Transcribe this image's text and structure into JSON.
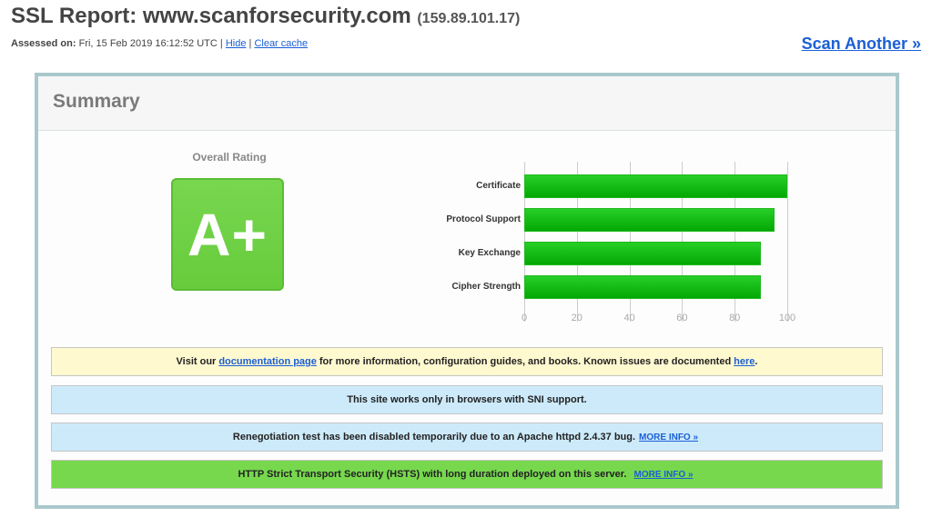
{
  "header": {
    "title_prefix": "SSL Report: ",
    "hostname": "www.scanforsecurity.com",
    "ip": "(159.89.101.17)",
    "assessed_label": "Assessed on:",
    "assessed_value": "Fri, 15 Feb 2019 16:12:52 UTC",
    "separator": "|",
    "hide_link": "Hide",
    "clear_cache_link": "Clear cache",
    "scan_another": "Scan Another »"
  },
  "summary": {
    "title": "Summary",
    "overall_rating_label": "Overall Rating",
    "grade": "A+",
    "grade_color": "#6fd144"
  },
  "chart_data": {
    "type": "bar",
    "orientation": "horizontal",
    "categories": [
      "Certificate",
      "Protocol Support",
      "Key Exchange",
      "Cipher Strength"
    ],
    "values": [
      100,
      95,
      90,
      90
    ],
    "xlim": [
      0,
      100
    ],
    "ticks": [
      "0",
      "20",
      "40",
      "60",
      "80",
      "100"
    ],
    "grid": true,
    "bar_color": "#14bc14"
  },
  "notices": [
    {
      "style": "yellow",
      "text_before": "Visit our",
      "link1": "documentation page",
      "text_middle": "for more information, configuration guides, and books. Known issues are documented",
      "link2": "here",
      "text_after": "."
    },
    {
      "style": "blue",
      "text": "This site works only in browsers with SNI support."
    },
    {
      "style": "blue",
      "text": "Renegotiation test has been disabled temporarily due to an Apache httpd 2.4.37 bug.",
      "link": "MORE INFO »"
    },
    {
      "style": "green",
      "text": "HTTP Strict Transport Security (HSTS) with long duration deployed on this server.",
      "link": "MORE INFO »"
    }
  ]
}
